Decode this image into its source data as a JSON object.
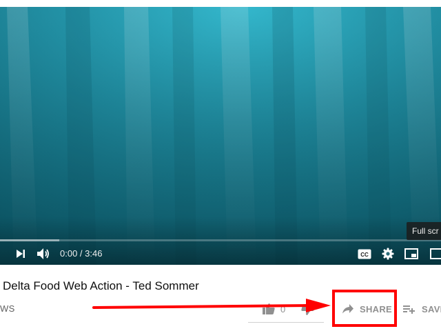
{
  "player": {
    "time_current": "0:00",
    "time_separator": " / ",
    "time_duration": "3:46",
    "progress_played_fraction": 0.0,
    "progress_buffered_fraction": 0.135,
    "fullscreen_tooltip": "Full scr"
  },
  "video": {
    "title": "Delta Food Web Action - Ted Sommer",
    "views_text": "WS"
  },
  "actions": {
    "like_count": "0",
    "share_label": "SHARE",
    "save_label": "SAVE"
  },
  "colors": {
    "water_deep": "#0f5f70",
    "water_light": "#2fb4cc",
    "annotation_red": "#ff0000",
    "icon_gray": "#909090"
  },
  "icons": {
    "next": "next-icon",
    "volume": "volume-icon",
    "captions": "captions-icon",
    "settings": "gear-icon",
    "miniplayer": "miniplayer-icon",
    "share": "share-arrow-icon",
    "save": "playlist-add-icon",
    "like": "thumbs-up-icon",
    "dislike": "thumbs-down-icon"
  }
}
